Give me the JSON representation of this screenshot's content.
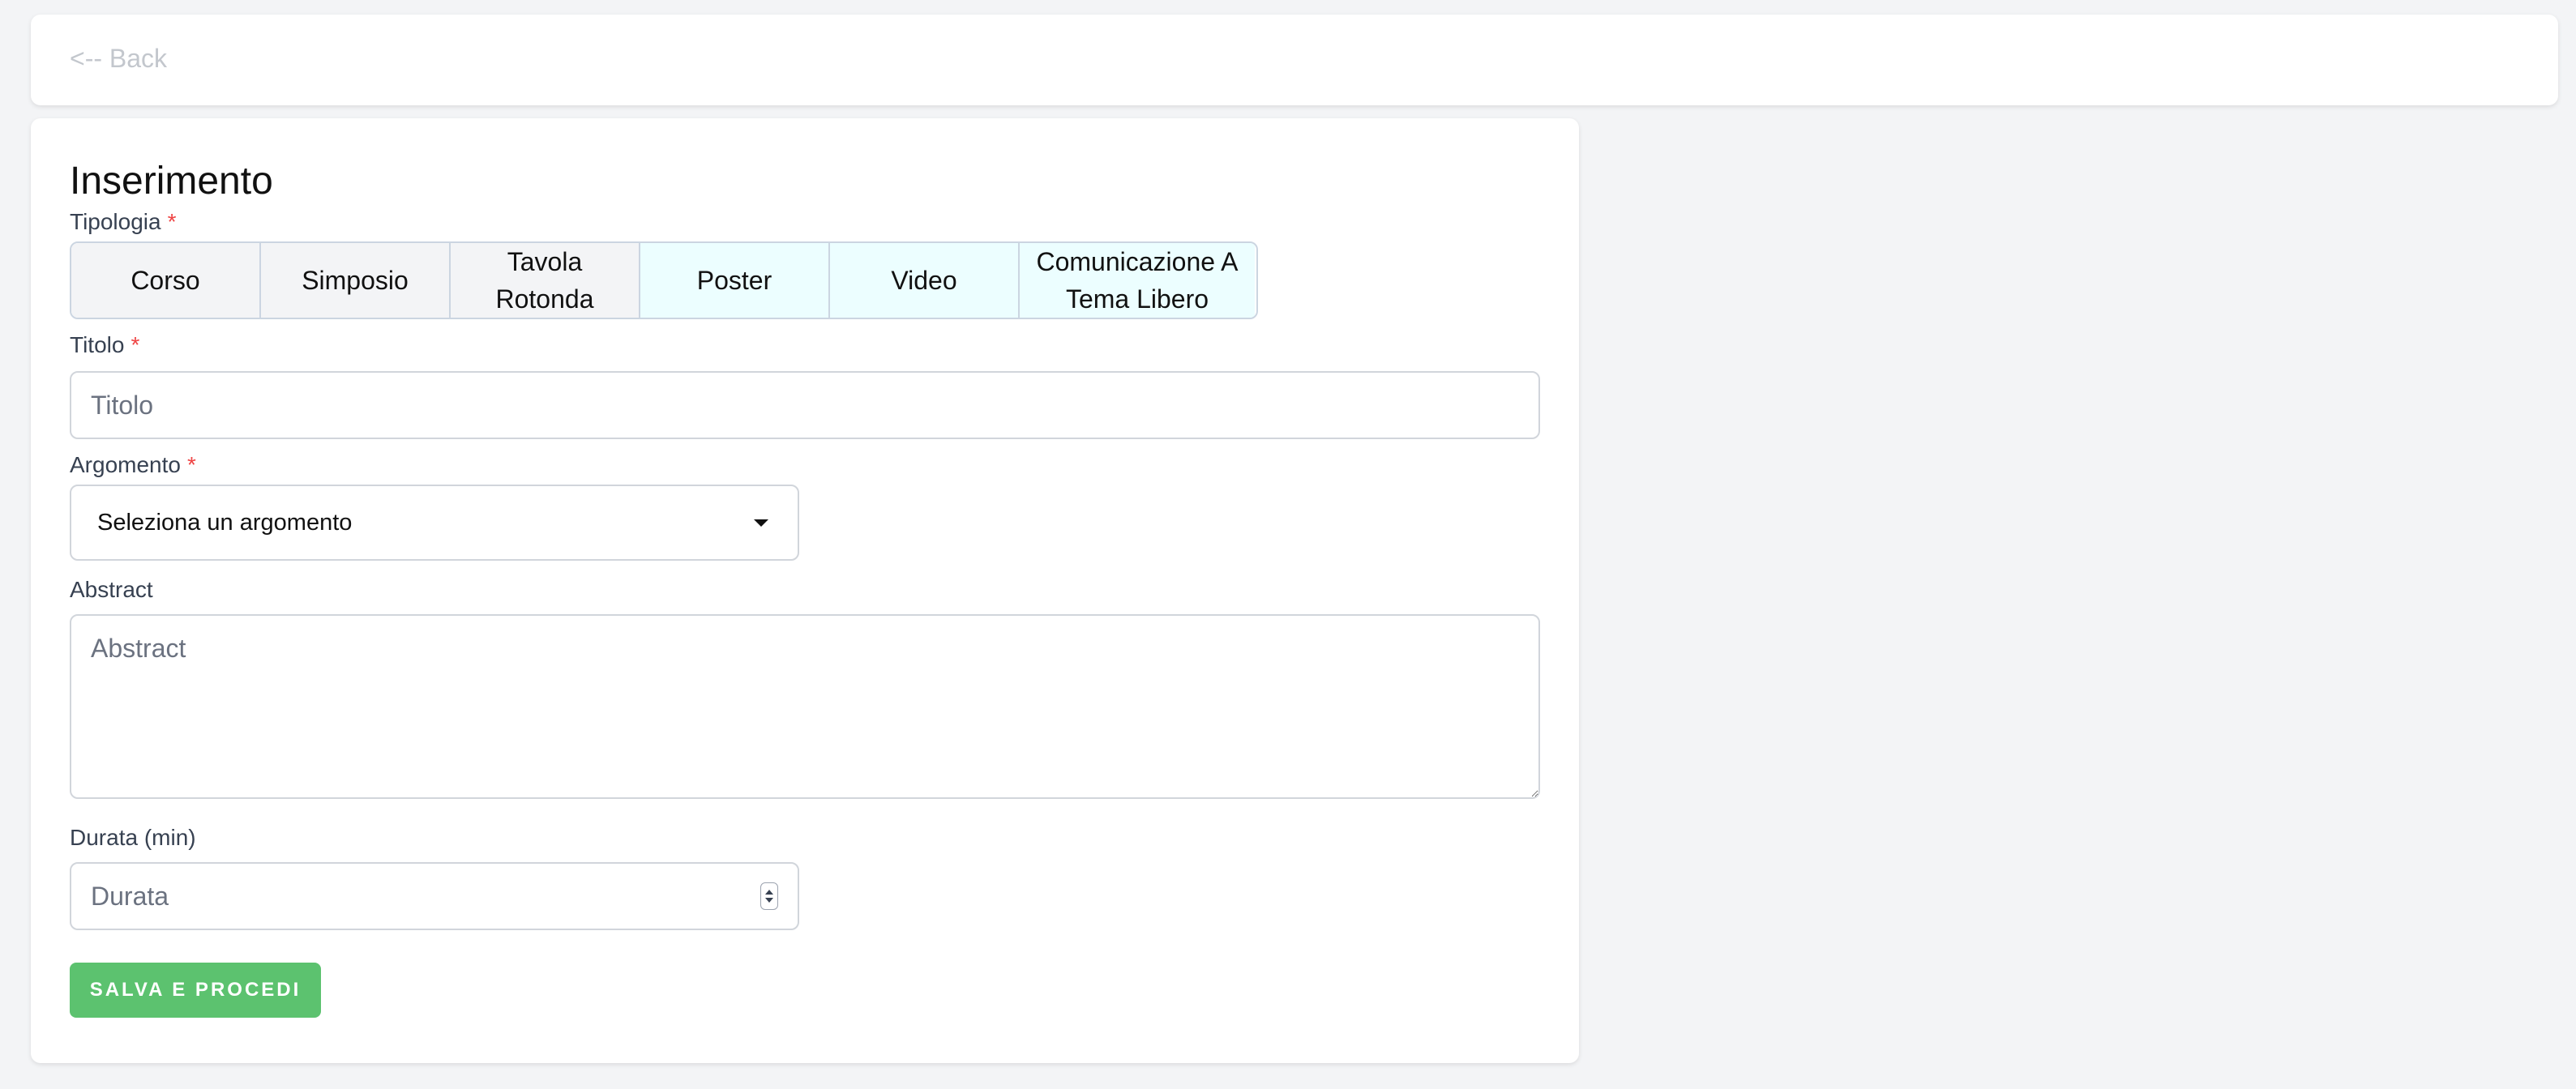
{
  "nav": {
    "back_label": "<-- Back"
  },
  "form": {
    "title": "Inserimento",
    "required_mark": "*",
    "tipologia": {
      "label": "Tipologia",
      "options": [
        "Corso",
        "Simposio",
        "Tavola Rotonda",
        "Poster",
        "Video",
        "Comunicazione A Tema Libero"
      ]
    },
    "titolo": {
      "label": "Titolo",
      "placeholder": "Titolo",
      "value": ""
    },
    "argomento": {
      "label": "Argomento",
      "selected": "Seleziona un argomento"
    },
    "abstract": {
      "label": "Abstract",
      "placeholder": "Abstract",
      "value": ""
    },
    "durata": {
      "label": "Durata (min)",
      "placeholder": "Durata",
      "value": ""
    },
    "submit_label": "SALVA E PROCEDI"
  },
  "colors": {
    "page_background": "#f3f4f6",
    "required": "#ef4444",
    "submit": "#5cc26f",
    "type_button_default": "#f3f4f6",
    "type_button_alt": "#ecfeff"
  },
  "icons": {
    "select_caret": "caret-down-icon",
    "number_spinner": "spinner-icon"
  }
}
